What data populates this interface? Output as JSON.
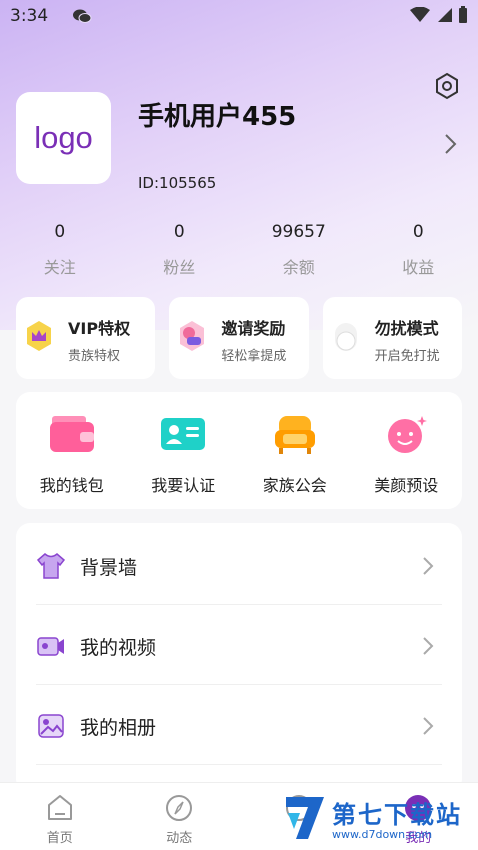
{
  "status_bar": {
    "time": "3:34"
  },
  "profile": {
    "avatar_text": "logo",
    "name": "手机用户455",
    "id_text": "ID:105565"
  },
  "stats": [
    {
      "value": "0",
      "label": "关注"
    },
    {
      "value": "0",
      "label": "粉丝"
    },
    {
      "value": "99657",
      "label": "余额"
    },
    {
      "value": "0",
      "label": "收益"
    }
  ],
  "feature_cards": [
    {
      "title": "VIP特权",
      "subtitle": "贵族特权",
      "icon": "crown-icon"
    },
    {
      "title": "邀请奖励",
      "subtitle": "轻松拿提成",
      "icon": "invite-reward-icon"
    },
    {
      "title": "勿扰模式",
      "subtitle": "开启免打扰",
      "icon": "toggle-icon"
    }
  ],
  "quick_grid": [
    {
      "label": "我的钱包",
      "icon": "wallet-icon"
    },
    {
      "label": "我要认证",
      "icon": "id-card-icon"
    },
    {
      "label": "家族公会",
      "icon": "sofa-icon"
    },
    {
      "label": "美颜预设",
      "icon": "beauty-face-icon"
    }
  ],
  "menu_list": [
    {
      "label": "背景墙",
      "icon": "shirt-icon"
    },
    {
      "label": "我的视频",
      "icon": "video-icon"
    },
    {
      "label": "我的相册",
      "icon": "photo-album-icon"
    }
  ],
  "tab_bar": [
    {
      "label": "首页",
      "icon": "home-icon"
    },
    {
      "label": "动态",
      "icon": "compass-icon"
    },
    {
      "label": "",
      "icon": "message-icon"
    },
    {
      "label": "我的",
      "icon": "profile-icon",
      "active": true
    }
  ],
  "watermark": {
    "title": "第七下载站",
    "url": "www.d7down.com"
  },
  "colors": {
    "accent": "#7a2fb6",
    "watermark": "#1d66c9"
  }
}
